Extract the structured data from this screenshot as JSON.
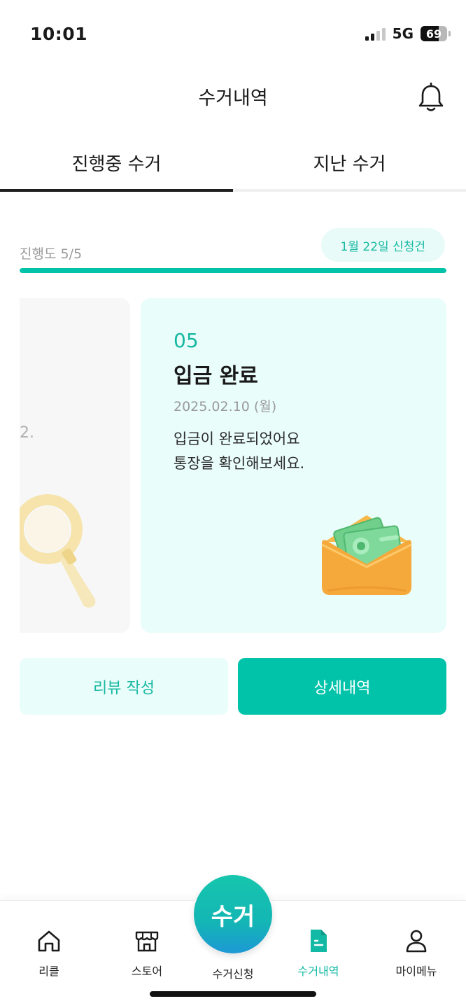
{
  "status": {
    "time": "10:01",
    "network": "5G",
    "battery": "69"
  },
  "header": {
    "title": "수거내역"
  },
  "tabs": [
    {
      "label": "진행중 수거",
      "active": true
    },
    {
      "label": "지난 수거",
      "active": false
    }
  ],
  "progress": {
    "label": "진행도 5/5",
    "value": 1.0,
    "date_pill": "1월 22일 신청건"
  },
  "cards": {
    "prev_fragment": "2.",
    "current": {
      "number": "05",
      "title": "입금 완료",
      "date": "2025.02.10 (월)",
      "desc_line1": "입금이 완료되었어요",
      "desc_line2": "통장을 확인해보세요."
    }
  },
  "buttons": {
    "review": "리뷰 작성",
    "detail": "상세내역"
  },
  "nav": {
    "items": [
      {
        "label": "리클",
        "icon": "home-icon"
      },
      {
        "label": "스토어",
        "icon": "store-icon"
      },
      {
        "label": "수거신청",
        "icon": "pickup-fab"
      },
      {
        "label": "수거내역",
        "icon": "document-icon",
        "active": true
      },
      {
        "label": "마이메뉴",
        "icon": "person-icon"
      }
    ],
    "fab_label": "수거"
  },
  "colors": {
    "accent": "#00c3a9",
    "accent_light": "#e9fdfb"
  }
}
